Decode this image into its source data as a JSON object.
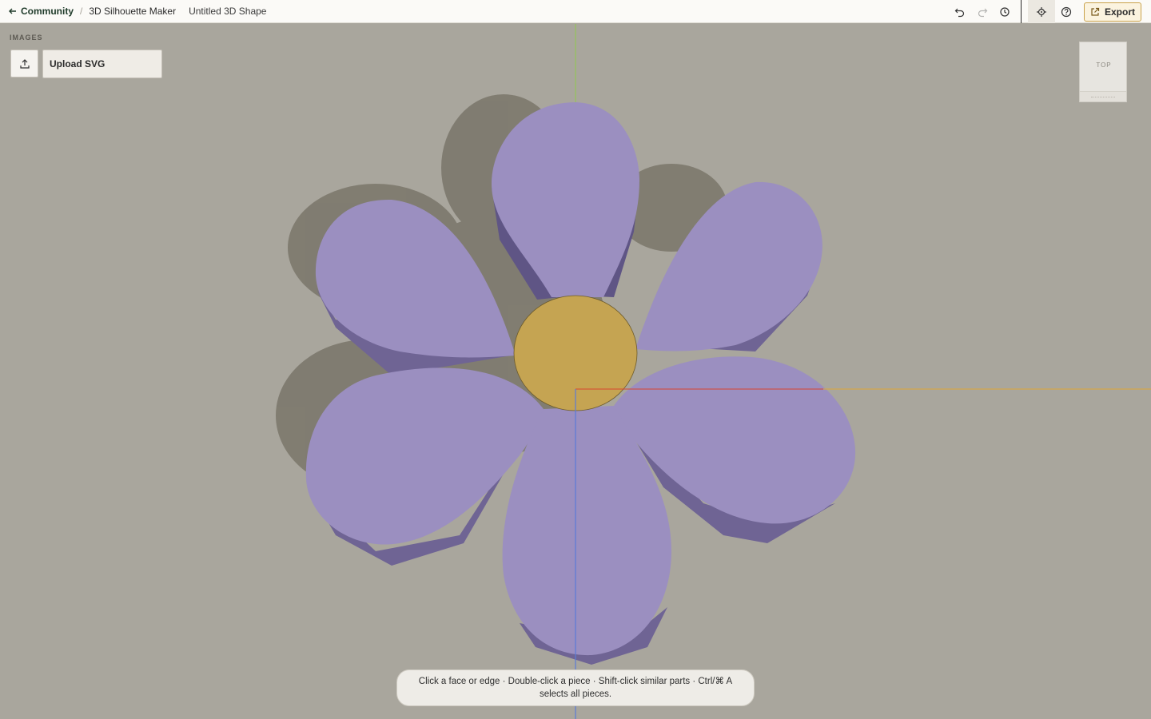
{
  "topbar": {
    "back_label": "Community",
    "app_name": "3D Silhouette Maker",
    "doc_title": "Untitled 3D Shape",
    "export_label": "Export",
    "tools": [
      "undo-icon",
      "redo-icon",
      "history-icon",
      "target-icon",
      "help-icon"
    ]
  },
  "panel": {
    "section_label": "IMAGES",
    "upload_label": "Upload SVG"
  },
  "viewcube": {
    "face": "TOP"
  },
  "hint": {
    "text": "Click a face or edge · Double-click a piece · Shift-click similar parts · Ctrl/⌘ A selects all pieces."
  },
  "model": {
    "petal_color": "#9b8fc0",
    "petal_side_color": "#6f6494",
    "center_color": "#c5a452",
    "petal_count": 6
  },
  "colors": {
    "accent": "#c9a24b",
    "x_axis": "#d9432f",
    "y_axis": "#8fc94d",
    "z_axis": "#5b7bd6"
  }
}
